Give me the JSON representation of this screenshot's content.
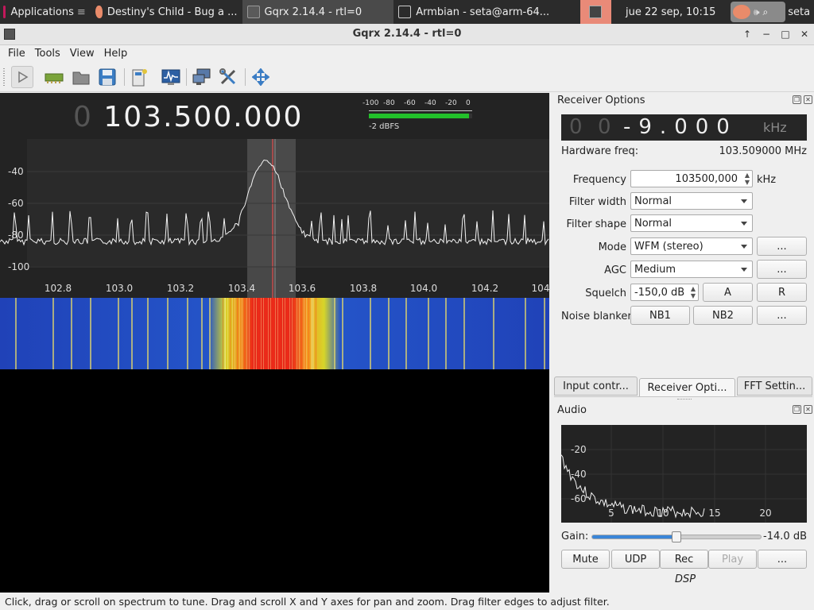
{
  "taskbar": {
    "apps_label": "Applications",
    "tasks": [
      {
        "label": "Destiny's Child - Bug a ...",
        "active": false
      },
      {
        "label": "Gqrx 2.14.4 - rtl=0",
        "active": true
      },
      {
        "label": "Armbian - seta@arm-64...",
        "active": false
      }
    ],
    "clock": "jue 22 sep, 10:15",
    "user": "seta"
  },
  "window": {
    "title": "Gqrx 2.14.4 - rtl=0"
  },
  "menu": [
    "File",
    "Tools",
    "View",
    "Help"
  ],
  "toolbar": {
    "icons": [
      "play-icon",
      "hardware-icon",
      "open-folder-icon",
      "save-icon",
      "remote-control-icon",
      "io-devices-icon",
      "network-icon",
      "tools-icon",
      "fullscreen-icon"
    ]
  },
  "display": {
    "freq_dim": "0",
    "freq_main": "103.500.000",
    "meter_ticks": [
      "-100",
      "-80",
      "-60",
      "-40",
      "-20",
      "0"
    ],
    "meter_level": 0.97,
    "meter_label": "-2 dBFS",
    "y_ticks": [
      "-40",
      "-60",
      "-80",
      "-100"
    ],
    "x_ticks": [
      "102.8",
      "103.0",
      "103.2",
      "103.4",
      "103.6",
      "103.8",
      "104.0",
      "104.2",
      "104"
    ]
  },
  "receiver": {
    "panel_title": "Receiver Options",
    "offset_digits_dim": [
      "0",
      "0"
    ],
    "offset_value": "-9.000",
    "offset_unit": "kHz",
    "hw_freq_label": "Hardware freq:",
    "hw_freq_value": "103.509000 MHz",
    "frequency_label": "Frequency",
    "frequency_value": "103500,000",
    "frequency_unit": "kHz",
    "filter_width_label": "Filter width",
    "filter_width_value": "Normal",
    "filter_shape_label": "Filter shape",
    "filter_shape_value": "Normal",
    "mode_label": "Mode",
    "mode_value": "WFM (stereo)",
    "agc_label": "AGC",
    "agc_value": "Medium",
    "squelch_label": "Squelch",
    "squelch_value": "-150,0 dB",
    "squelch_a": "A",
    "squelch_r": "R",
    "noise_label": "Noise blanker",
    "nb1": "NB1",
    "nb2": "NB2",
    "more": "..."
  },
  "tabs": [
    "Input contr...",
    "Receiver Opti...",
    "FFT Settin..."
  ],
  "audio": {
    "panel_title": "Audio",
    "y_ticks": [
      "-20",
      "-40",
      "-60"
    ],
    "x_ticks": [
      "5",
      "10",
      "15",
      "20"
    ],
    "gain_label": "Gain:",
    "gain_value": "-14.0 dB",
    "gain_level": 0.5,
    "buttons": [
      "Mute",
      "UDP",
      "Rec",
      "Play",
      "..."
    ],
    "dsp_label": "DSP"
  },
  "status": "Click, drag or scroll on spectrum to tune. Drag and scroll X and Y axes for pan and zoom. Drag filter edges to adjust filter."
}
